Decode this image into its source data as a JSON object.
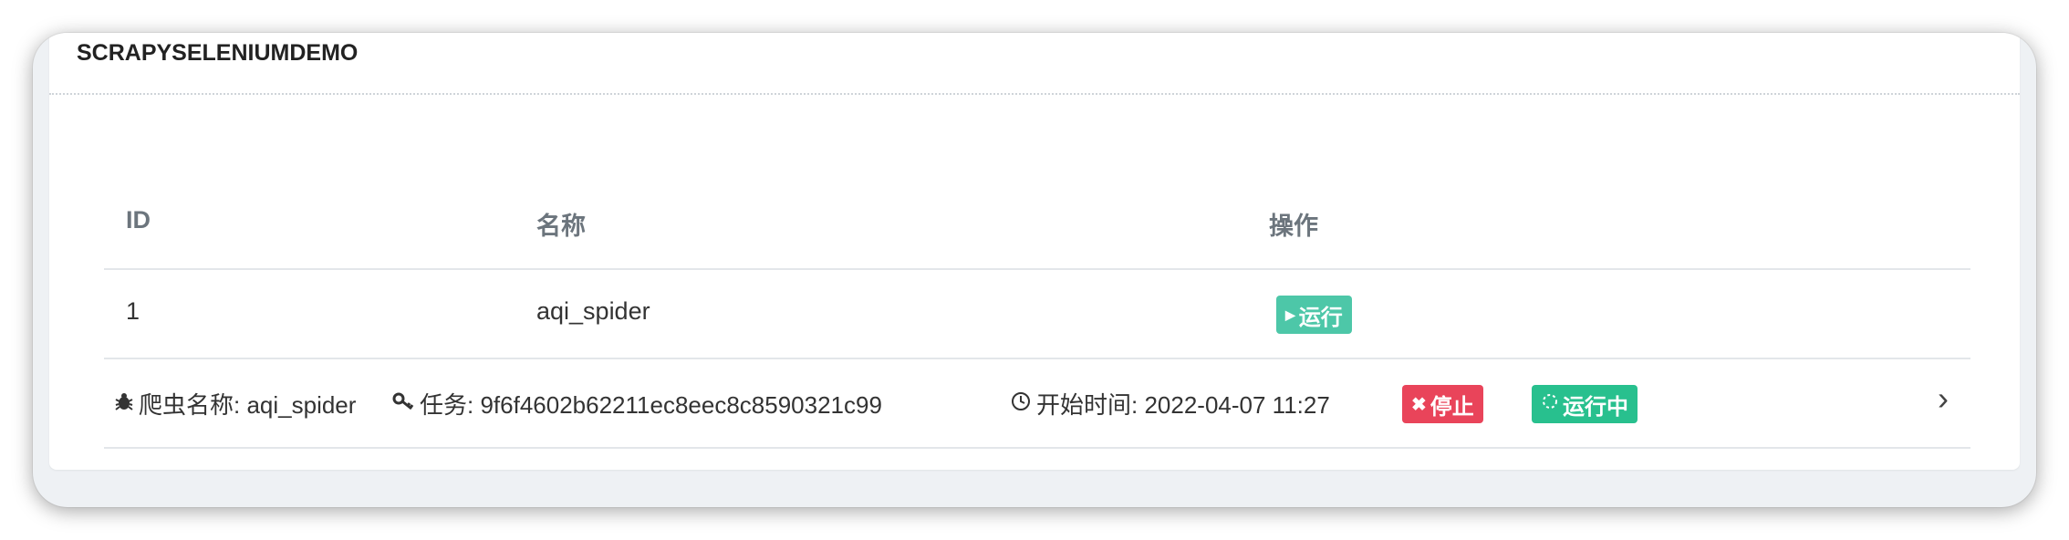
{
  "panel": {
    "title": "SCRAPYSELENIUMDEMO"
  },
  "table": {
    "headers": [
      "ID",
      "名称",
      "操作"
    ],
    "rows": [
      {
        "id": "1",
        "name": "aqi_spider",
        "action_label": "运行"
      }
    ]
  },
  "job": {
    "spider_label": "爬虫名称: aqi_spider",
    "task_label": "任务: 9f6f4602b62211ec8eec8c8590321c99",
    "start_label": "开始时间: 2022-04-07 11:27",
    "stop_label": "停止",
    "status_label": "运行中"
  },
  "icons": {
    "spider": "bug-icon",
    "task": "key-icon",
    "time": "clock-icon",
    "stop": "close-icon",
    "status": "spinner-icon",
    "expand": "chevron-right-icon",
    "run": "play-icon"
  },
  "colors": {
    "run": "#4dc7a8",
    "stop": "#e9445a",
    "running": "#28c08e"
  }
}
